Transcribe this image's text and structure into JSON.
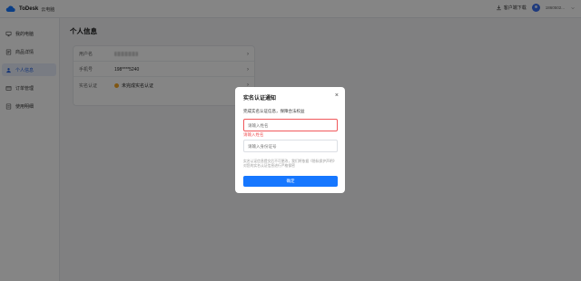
{
  "app": {
    "name": "ToDesk",
    "sub": "云电脑"
  },
  "topbar": {
    "download": "客户端下载",
    "user": "1860502..."
  },
  "sidebar": {
    "items": [
      {
        "label": "我的电脑",
        "icon": "computer-icon"
      },
      {
        "label": "商品详情",
        "icon": "product-icon"
      },
      {
        "label": "个人信息",
        "icon": "user-icon"
      },
      {
        "label": "订单管理",
        "icon": "order-icon"
      },
      {
        "label": "使用明细",
        "icon": "usage-icon"
      }
    ],
    "active_index": 2
  },
  "page": {
    "title": "个人信息",
    "rows": [
      {
        "label": "用户名",
        "value": ""
      },
      {
        "label": "手机号",
        "value": "198****5240"
      },
      {
        "label": "实名认证",
        "value": "未完成实名认证"
      }
    ]
  },
  "modal": {
    "title": "实名认证通知",
    "close": "×",
    "desc": "完成实名认证信息，保障合法权益",
    "name_placeholder": "请输入姓名",
    "name_error": "请输入姓名",
    "id_placeholder": "请输入身份证号",
    "note": "实名认证信息提交后不可更改，我们将依据《隐私保护声明》对您的实名认证信息进行严格保密",
    "confirm": "确定"
  },
  "colors": {
    "accent": "#1677ff",
    "error": "#f0585b",
    "warning": "#f5a623"
  }
}
